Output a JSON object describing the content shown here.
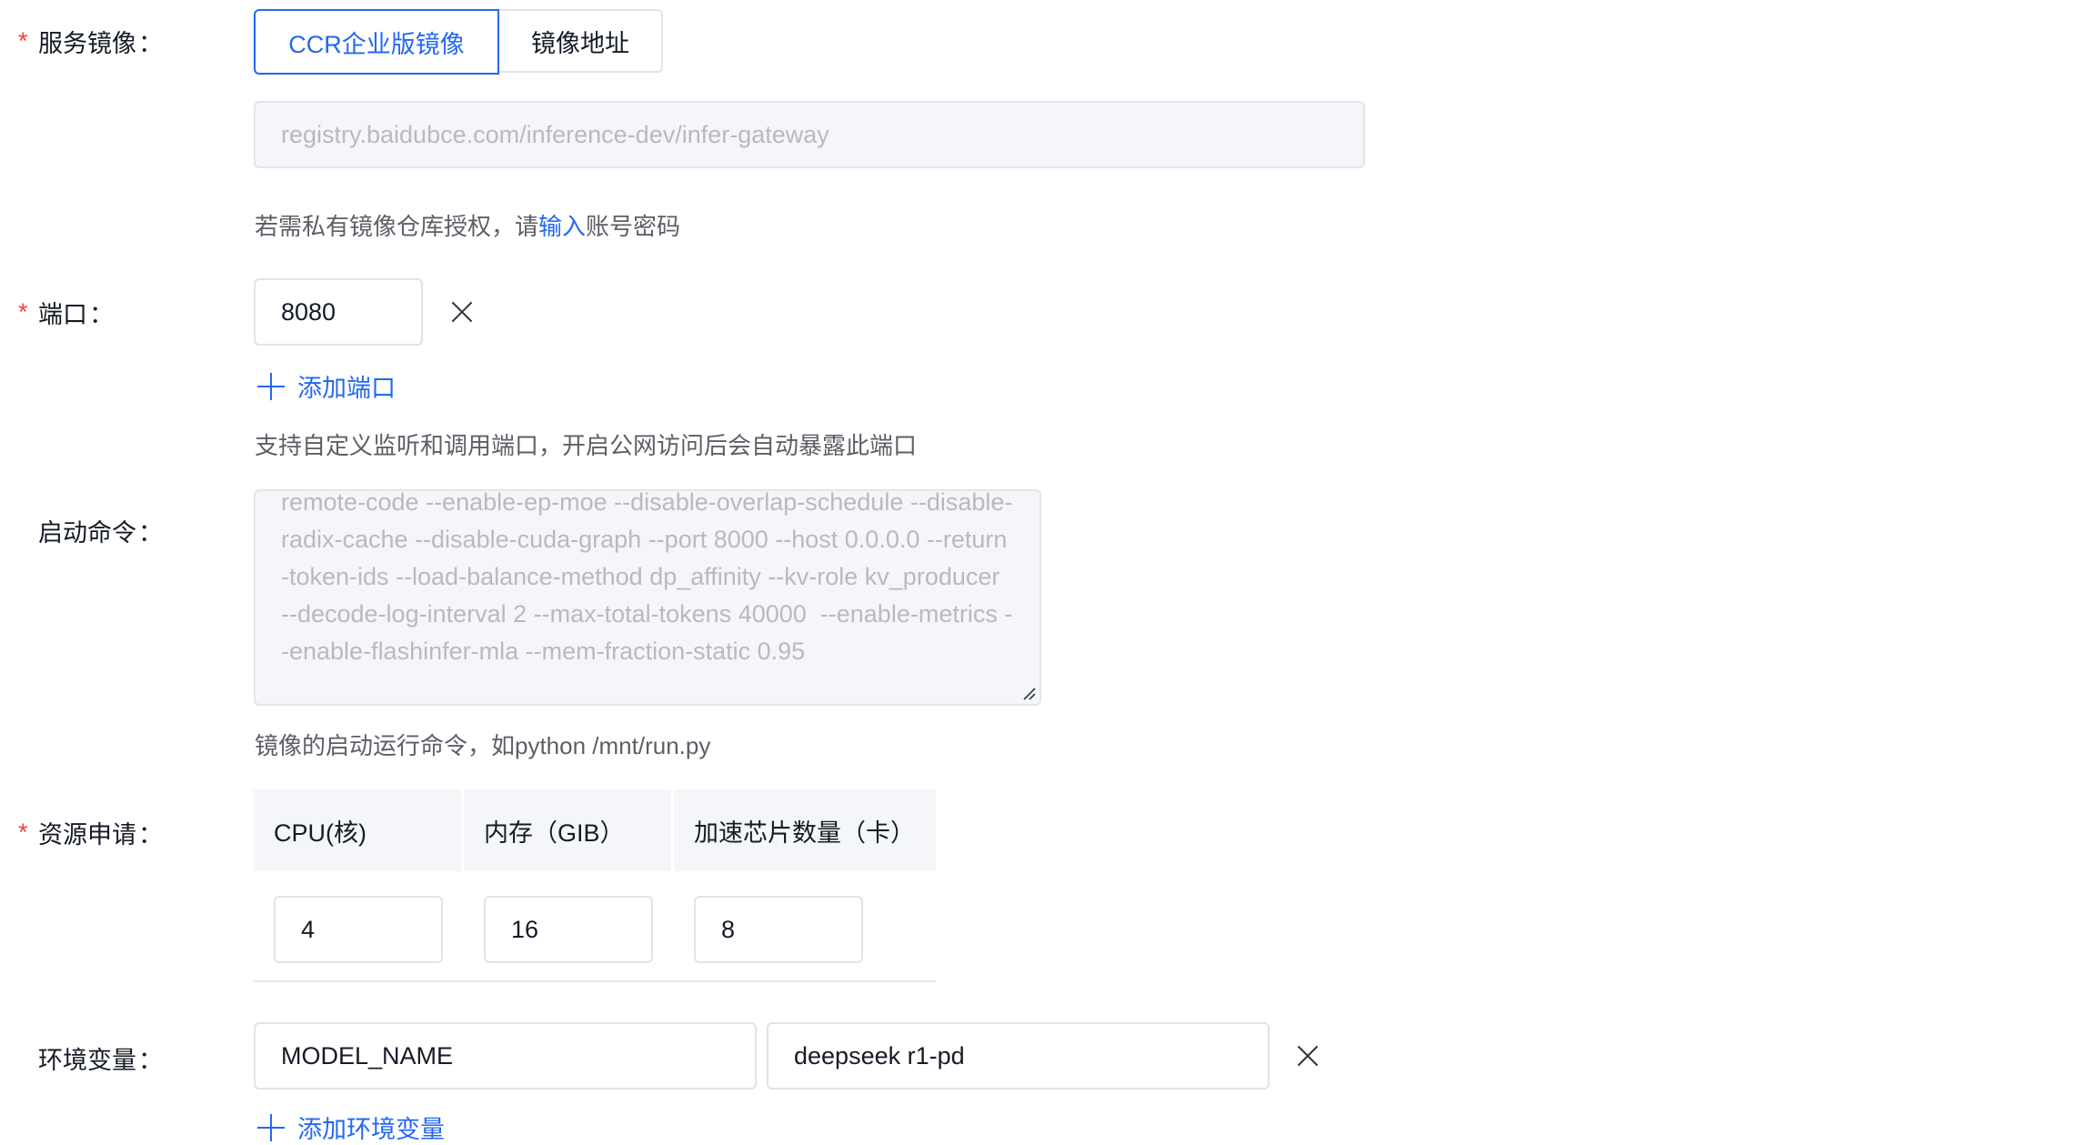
{
  "service_image": {
    "label": "服务镜像",
    "tabs": [
      {
        "label": "CCR企业版镜像",
        "active": true
      },
      {
        "label": "镜像地址",
        "active": false
      }
    ],
    "image_value": "registry.baidubce.com/inference-dev/infer-gateway",
    "hint_prefix": "若需私有镜像仓库授权，请",
    "hint_link": "输入",
    "hint_suffix": "账号密码"
  },
  "port": {
    "label": "端口",
    "value": "8080",
    "add_label": "添加端口",
    "hint": "支持自定义监听和调用端口，开启公网访问后会自动暴露此端口"
  },
  "startup_command": {
    "label": "启动命令",
    "value": "remote-code --enable-ep-moe --disable-overlap-schedule --disable-radix-cache --disable-cuda-graph --port 8000 --host 0.0.0.0 --return-token-ids --load-balance-method dp_affinity --kv-role kv_producer --decode-log-interval 2 --max-total-tokens 40000  --enable-metrics --enable-flashinfer-mla --mem-fraction-static 0.95",
    "hint": "镜像的启动运行命令，如python /mnt/run.py"
  },
  "resources": {
    "label": "资源申请",
    "columns": [
      "CPU(核)",
      "内存（GIB）",
      "加速芯片数量（卡）"
    ],
    "values": [
      "4",
      "16",
      "8"
    ]
  },
  "env": {
    "label": "环境变量",
    "key": "MODEL_NAME",
    "value": "deepseek r1-pd",
    "add_label": "添加环境变量"
  },
  "colon": "："
}
